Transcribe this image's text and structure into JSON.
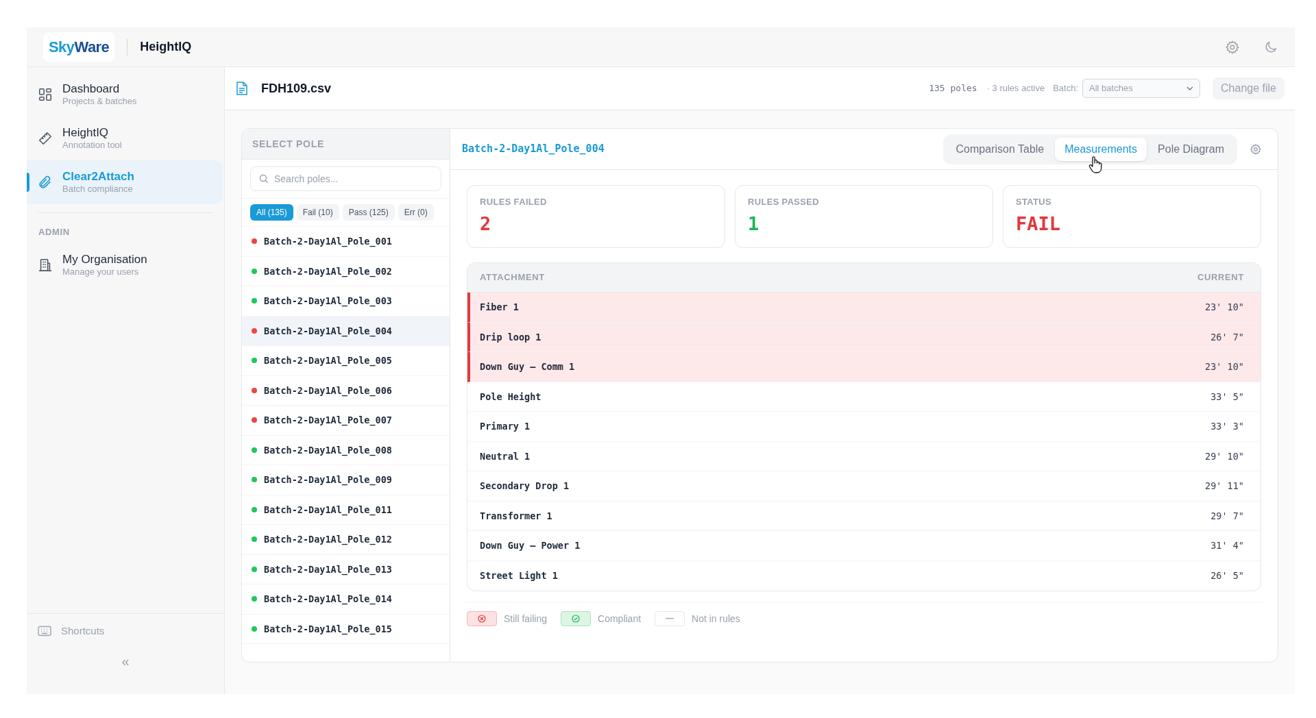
{
  "header": {
    "logo": "SkyWare",
    "app_title": "HeightIQ"
  },
  "sidebar": {
    "items": [
      {
        "kind": "grid",
        "label": "Dashboard",
        "sublabel": "Projects & batches",
        "selected": false
      },
      {
        "kind": "ruler",
        "label": "HeightIQ",
        "sublabel": "Annotation tool",
        "selected": false
      },
      {
        "kind": "clip",
        "label": "Clear2Attach",
        "sublabel": "Batch compliance",
        "selected": true
      }
    ],
    "section": "ADMIN",
    "admin_items": [
      {
        "kind": "building",
        "label": "My Organisation",
        "sublabel": "Manage your users",
        "selected": false
      }
    ],
    "shortcuts": "Shortcuts",
    "collapse": "«"
  },
  "topbar": {
    "file": "FDH109.csv",
    "poles": "135 poles",
    "rules": "· 3 rules active",
    "batch_label": "Batch:",
    "batch_value": "All batches",
    "change_button": "Change file"
  },
  "pole_list": {
    "title": "SELECT POLE",
    "search_placeholder": "Search poles...",
    "filters": [
      {
        "label": "All (135)",
        "selected": true
      },
      {
        "label": "Fail (10)",
        "selected": false
      },
      {
        "label": "Pass (125)",
        "selected": false
      },
      {
        "label": "Err (0)",
        "selected": false
      }
    ],
    "poles": [
      {
        "name": "Batch-2-Day1Al_Pole_001",
        "color": "#ef4444",
        "selected": false
      },
      {
        "name": "Batch-2-Day1Al_Pole_002",
        "color": "#22c55e",
        "selected": false
      },
      {
        "name": "Batch-2-Day1Al_Pole_003",
        "color": "#22c55e",
        "selected": false
      },
      {
        "name": "Batch-2-Day1Al_Pole_004",
        "color": "#ef4444",
        "selected": true
      },
      {
        "name": "Batch-2-Day1Al_Pole_005",
        "color": "#22c55e",
        "selected": false
      },
      {
        "name": "Batch-2-Day1Al_Pole_006",
        "color": "#ef4444",
        "selected": false
      },
      {
        "name": "Batch-2-Day1Al_Pole_007",
        "color": "#ef4444",
        "selected": false
      },
      {
        "name": "Batch-2-Day1Al_Pole_008",
        "color": "#22c55e",
        "selected": false
      },
      {
        "name": "Batch-2-Day1Al_Pole_009",
        "color": "#22c55e",
        "selected": false
      },
      {
        "name": "Batch-2-Day1Al_Pole_011",
        "color": "#22c55e",
        "selected": false
      },
      {
        "name": "Batch-2-Day1Al_Pole_012",
        "color": "#22c55e",
        "selected": false
      },
      {
        "name": "Batch-2-Day1Al_Pole_013",
        "color": "#22c55e",
        "selected": false
      },
      {
        "name": "Batch-2-Day1Al_Pole_014",
        "color": "#22c55e",
        "selected": false
      },
      {
        "name": "Batch-2-Day1Al_Pole_015",
        "color": "#22c55e",
        "selected": false
      }
    ]
  },
  "detail": {
    "pole_title": "Batch-2-Day1Al_Pole_004",
    "tabs": [
      {
        "label": "Comparison Table",
        "selected": false
      },
      {
        "label": "Measurements",
        "selected": true
      },
      {
        "label": "Pole Diagram",
        "selected": false
      }
    ],
    "stats": [
      {
        "kind": "fail",
        "label": "RULES FAILED",
        "value": "2"
      },
      {
        "kind": "pass",
        "label": "RULES PASSED",
        "value": "1"
      },
      {
        "kind": "fail",
        "label": "STATUS",
        "value": "FAIL"
      }
    ],
    "table": {
      "columns": [
        "ATTACHMENT",
        "CURRENT"
      ],
      "rows": [
        {
          "attachment": "Fiber 1",
          "current": "23' 10\"",
          "failing": true
        },
        {
          "attachment": "Drip loop 1",
          "current": "26' 7\"",
          "failing": true
        },
        {
          "attachment": "Down Guy – Comm 1",
          "current": "23' 10\"",
          "failing": true
        },
        {
          "attachment": "Pole Height",
          "current": "33' 5\"",
          "failing": false
        },
        {
          "attachment": "Primary 1",
          "current": "33' 3\"",
          "failing": false
        },
        {
          "attachment": "Neutral 1",
          "current": "29' 10\"",
          "failing": false
        },
        {
          "attachment": "Secondary Drop 1",
          "current": "29' 11\"",
          "failing": false
        },
        {
          "attachment": "Transformer 1",
          "current": "29' 7\"",
          "failing": false
        },
        {
          "attachment": "Down Guy – Power 1",
          "current": "31' 4\"",
          "failing": false
        },
        {
          "attachment": "Street Light 1",
          "current": "26' 5\"",
          "failing": false
        }
      ]
    },
    "legend": [
      {
        "kind": "fail",
        "label": "Still failing"
      },
      {
        "kind": "pass",
        "label": "Compliant"
      },
      {
        "kind": "none",
        "label": "Not in rules"
      }
    ]
  }
}
